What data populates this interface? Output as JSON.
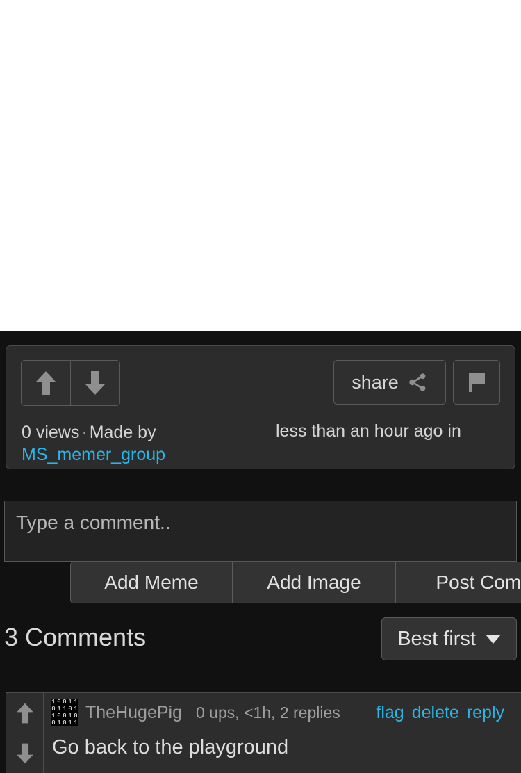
{
  "post": {
    "actions": {
      "upvote_icon": "arrow-up-icon",
      "downvote_icon": "arrow-down-icon",
      "share_label": "share",
      "share_icon": "share-nodes-icon",
      "flag_icon": "flag-icon"
    },
    "stats": {
      "views": "0 views",
      "separator": "·",
      "made_by_label": "Made by",
      "author": "MS_memer_group",
      "time_ago": "less than an hour ago in"
    }
  },
  "composer": {
    "placeholder": "Type a comment..",
    "value": "",
    "buttons": {
      "add_meme": "Add Meme",
      "add_image": "Add Image",
      "post_comment": "Post Comment"
    }
  },
  "comments_section": {
    "count_label": "3 Comments",
    "sort": {
      "selected": "Best first",
      "caret_icon": "chevron-down-icon"
    },
    "items": [
      {
        "avatar_icon": "binary-avatar-icon",
        "avatar_bits": [
          "1",
          "0",
          "0",
          "1",
          "1",
          "0",
          "1",
          "1",
          "0",
          "1",
          "1",
          "0",
          "0",
          "1",
          "0",
          "0",
          "1",
          "0",
          "1",
          "1"
        ],
        "author": "TheHugePig",
        "meta": "0 ups, <1h, 2 replies",
        "links": {
          "flag": "flag",
          "delete": "delete",
          "reply": "reply"
        },
        "text": "Go back to the playground",
        "upvote_icon": "arrow-up-icon",
        "downvote_icon": "arrow-down-icon"
      }
    ]
  },
  "colors": {
    "page_background": "#111111",
    "card_background": "#2c2c2c",
    "media_background": "#ffffff",
    "link_accent": "#29b6e8",
    "text_primary": "#dddddd",
    "text_muted": "#9e9e9e",
    "border": "#4d4d4d"
  }
}
